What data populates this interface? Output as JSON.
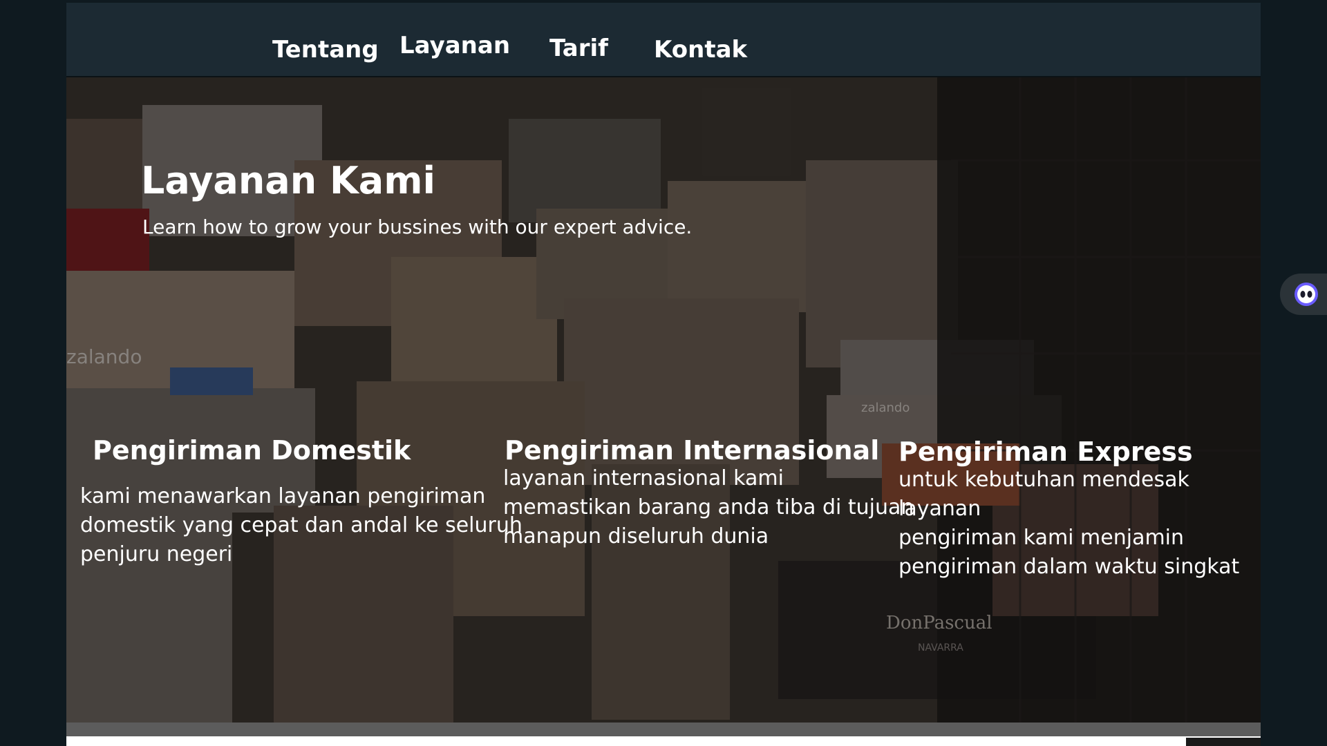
{
  "nav": {
    "items": [
      {
        "label": "Tentang"
      },
      {
        "label": "Layanan"
      },
      {
        "label": "Tarif"
      },
      {
        "label": "Kontak"
      }
    ]
  },
  "hero": {
    "title": "Layanan Kami",
    "subtitle": "Learn how to grow your bussines with our expert advice."
  },
  "services": [
    {
      "title": "Pengiriman Domestik",
      "lines": [
        "kami menawarkan layanan pengiriman",
        "domestik yang cepat dan andal ke seluruh",
        "penjuru negeri"
      ]
    },
    {
      "title": "Pengiriman Internasional",
      "lines": [
        "layanan internasional kami",
        "memastikan barang anda tiba di tujuan",
        "manapun diseluruh dunia"
      ]
    },
    {
      "title": "Pengiriman Express",
      "lines": [
        "untuk kebutuhan mendesak layanan",
        "pengiriman kami  menjamin",
        "pengiriman dalam waktu singkat"
      ]
    }
  ],
  "background_labels": {
    "brand_left": "zalando",
    "brand_right": "zalando",
    "brand_bottom": "DonPascual",
    "brand_bottom_sub": "NAVARRA"
  },
  "colors": {
    "navbar_bg": "#1c2a33",
    "page_bg": "#0f1a20",
    "text": "#ffffff",
    "float_accent": "#6a5cff"
  },
  "icons": {
    "assistant": "assistant-face-icon"
  }
}
